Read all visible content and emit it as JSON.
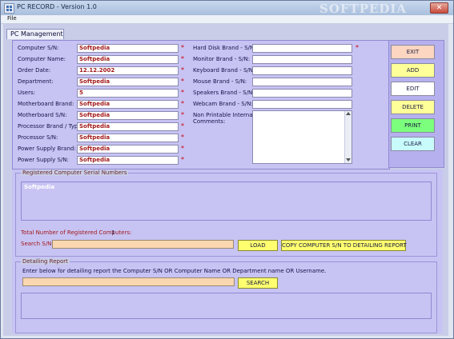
{
  "window": {
    "title": "PC RECORD - Version 1.0",
    "watermark": "SOFTPEDIA",
    "close_glyph": "✕"
  },
  "menu": {
    "file": "File"
  },
  "tab": {
    "label": "PC Management"
  },
  "form_left": [
    {
      "label": "Computer S/N:",
      "value": "Softpedia",
      "required": true
    },
    {
      "label": "Computer Name:",
      "value": "Softpedia",
      "required": true
    },
    {
      "label": "Order Date:",
      "value": "12.12.2002",
      "required": true
    },
    {
      "label": "Department:",
      "value": "Softpedia",
      "required": true
    },
    {
      "label": "Users:",
      "value": "5",
      "required": true
    },
    {
      "label": "Motherboard Brand:",
      "value": "Softpedia",
      "required": true
    },
    {
      "label": "Motherboard S/N:",
      "value": "Softpedia",
      "required": true
    },
    {
      "label": "Processor Brand / Type:",
      "value": "Softpedia",
      "required": true
    },
    {
      "label": "Processor S/N:",
      "value": "Softpedia",
      "required": true
    },
    {
      "label": "Power Supply Brand:",
      "value": "Softpedia",
      "required": true
    },
    {
      "label": "Power Supply S/N:",
      "value": "Softpedia",
      "required": true
    }
  ],
  "form_right": [
    {
      "label": "Hard Disk Brand - S/N:",
      "value": "",
      "required": true
    },
    {
      "label": "Monitor Brand - S/N:",
      "value": "",
      "required": false
    },
    {
      "label": "Keyboard Brand - S/N:",
      "value": "",
      "required": false
    },
    {
      "label": "Mouse Brand - S/N:",
      "value": "",
      "required": false
    },
    {
      "label": "Speakers Brand - S/N:",
      "value": "",
      "required": false
    },
    {
      "label": "Webcam Brand - S/N:",
      "value": "",
      "required": false
    }
  ],
  "comments": {
    "label_line1": "Non Printable Internal",
    "label_line2": "Comments:"
  },
  "required_marker": "*",
  "actions": [
    {
      "label": "EXIT",
      "color": "#fcd6c0"
    },
    {
      "label": "ADD",
      "color": "#ffff9a"
    },
    {
      "label": "EDIT",
      "color": "#ffffff"
    },
    {
      "label": "DELETE",
      "color": "#ffff9a"
    },
    {
      "label": "PRINT",
      "color": "#7cff7c"
    },
    {
      "label": "CLEAR",
      "color": "#c8fcfc"
    }
  ],
  "registered": {
    "group_title": "Registered Computer Serial Numbers",
    "items": [
      "Softpedia"
    ],
    "total_label": "Total Number of Registered Computers:",
    "total_value": "1",
    "search_label": "Search S/N:",
    "load_button": "LOAD",
    "copy_button": "COPY COMPUTER S/N TO DETAILING REPORT"
  },
  "detailing": {
    "group_title": "Detailing Report",
    "instruction": "Enter below for detailing report the Computer S/N OR Computer Name OR Department name OR Username.",
    "search_button": "SEARCH"
  }
}
